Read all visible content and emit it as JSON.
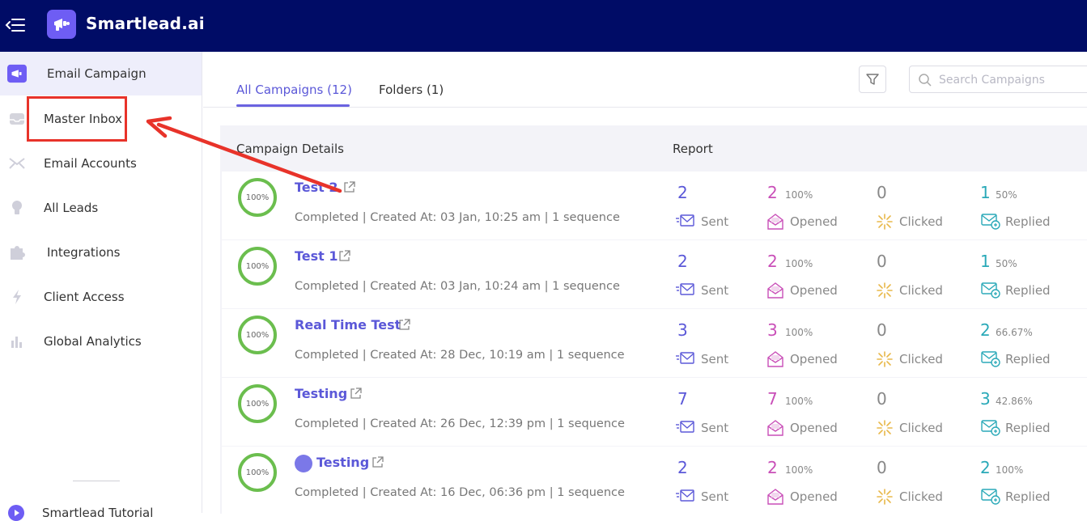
{
  "app": {
    "title": "Smartlead.ai"
  },
  "colors": {
    "topbar": "#000c66",
    "accent": "#5b58d8",
    "highlight": "#e8332a",
    "ring": "#6bbe4e"
  },
  "sidebar": {
    "items": [
      {
        "label": "Email Campaign",
        "icon": "megaphone-icon",
        "active": true
      },
      {
        "label": "Master Inbox",
        "icon": "inbox-icon"
      },
      {
        "label": "Email Accounts",
        "icon": "envelope-icon"
      },
      {
        "label": "All Leads",
        "icon": "lightbulb-icon"
      },
      {
        "label": "Integrations",
        "icon": "puzzle-icon"
      },
      {
        "label": "Client Access",
        "icon": "bolt-icon"
      },
      {
        "label": "Global Analytics",
        "icon": "bar-chart-icon"
      }
    ],
    "tutorial_label": "Smartlead Tutorial"
  },
  "tabs": {
    "all": "All Campaigns (12)",
    "folders": "Folders (1)"
  },
  "search": {
    "placeholder": "Search Campaigns"
  },
  "table": {
    "details_header": "Campaign Details",
    "report_header": "Report"
  },
  "labels": {
    "sent": "Sent",
    "opened": "Opened",
    "clicked": "Clicked",
    "replied": "Replied"
  },
  "campaigns": [
    {
      "progress": "100%",
      "name": "Test 2",
      "meta": "Completed | Created At: 03 Jan, 10:25 am | 1 sequence",
      "sent": "2",
      "opened": "2",
      "opened_pct": "100%",
      "clicked": "0",
      "replied": "1",
      "replied_pct": "50%"
    },
    {
      "progress": "100%",
      "name": "Test 1",
      "meta": "Completed | Created At: 03 Jan, 10:24 am | 1 sequence",
      "sent": "2",
      "opened": "2",
      "opened_pct": "100%",
      "clicked": "0",
      "replied": "1",
      "replied_pct": "50%"
    },
    {
      "progress": "100%",
      "name": "Real Time Test",
      "meta": "Completed | Created At: 28 Dec, 10:19 am | 1 sequence",
      "sent": "3",
      "opened": "3",
      "opened_pct": "100%",
      "clicked": "0",
      "replied": "2",
      "replied_pct": "66.67%"
    },
    {
      "progress": "100%",
      "name": "Testing",
      "meta": "Completed | Created At: 26 Dec, 12:39 pm | 1 sequence",
      "sent": "7",
      "opened": "7",
      "opened_pct": "100%",
      "clicked": "0",
      "replied": "3",
      "replied_pct": "42.86%"
    },
    {
      "progress": "100%",
      "name": "Testing",
      "meta": "Completed | Created At: 16 Dec, 06:36 pm | 1 sequence",
      "sent": "2",
      "opened": "2",
      "opened_pct": "100%",
      "clicked": "0",
      "replied": "2",
      "replied_pct": "100%",
      "has_avatar": true
    }
  ]
}
